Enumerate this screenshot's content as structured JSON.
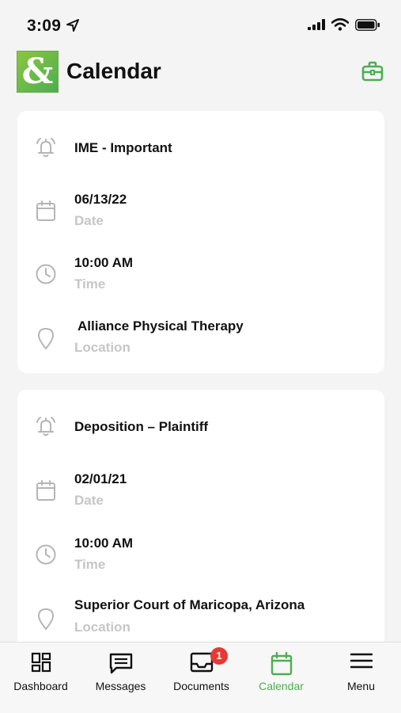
{
  "status_bar": {
    "time": "3:09",
    "icons": [
      "location-arrow-icon",
      "signal-icon",
      "wifi-icon",
      "battery-icon"
    ]
  },
  "header": {
    "title": "Calendar",
    "logo_icon": "app-logo-icon",
    "action_icon": "briefcase-icon"
  },
  "events": [
    {
      "title": "IME - Important",
      "date": "06/13/22",
      "date_label": "Date",
      "time": "10:00 AM",
      "time_label": "Time",
      "location": "Alliance Physical Therapy",
      "location_label": "Location"
    },
    {
      "title": "Deposition – Plaintiff",
      "date": "02/01/21",
      "date_label": "Date",
      "time": "10:00 AM",
      "time_label": "Time",
      "location": "Superior Court of Maricopa, Arizona",
      "location_label": "Location"
    }
  ],
  "tabs": [
    {
      "label": "Dashboard",
      "icon": "dashboard-icon",
      "active": false
    },
    {
      "label": "Messages",
      "icon": "messages-icon",
      "active": false
    },
    {
      "label": "Documents",
      "icon": "documents-icon",
      "active": false,
      "badge": "1"
    },
    {
      "label": "Calendar",
      "icon": "calendar-icon",
      "active": true
    },
    {
      "label": "Menu",
      "icon": "menu-icon",
      "active": false
    }
  ],
  "colors": {
    "accent": "#4caf50",
    "badge": "#e53935",
    "secondary_text": "#c6c6c6",
    "icon_gray": "#b5b5b5"
  }
}
